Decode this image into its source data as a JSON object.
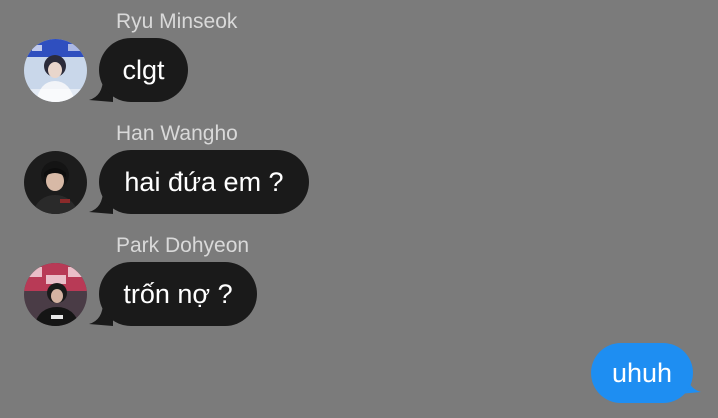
{
  "conversation": {
    "messages": [
      {
        "sender": "Ryu Minseok",
        "text": "clgt",
        "avatar_icon": "profile-photo"
      },
      {
        "sender": "Han Wangho",
        "text": "hai đứa em ?",
        "avatar_icon": "profile-photo"
      },
      {
        "sender": "Park Dohyeon",
        "text": "trốn nợ ?",
        "avatar_icon": "profile-photo"
      }
    ],
    "outgoing": {
      "text": "uhuh"
    }
  },
  "colors": {
    "background": "#7b7b7b",
    "received_bubble": "#1a1a1a",
    "sent_bubble": "#1e8ef2",
    "sender_name": "#d9d9d9"
  }
}
